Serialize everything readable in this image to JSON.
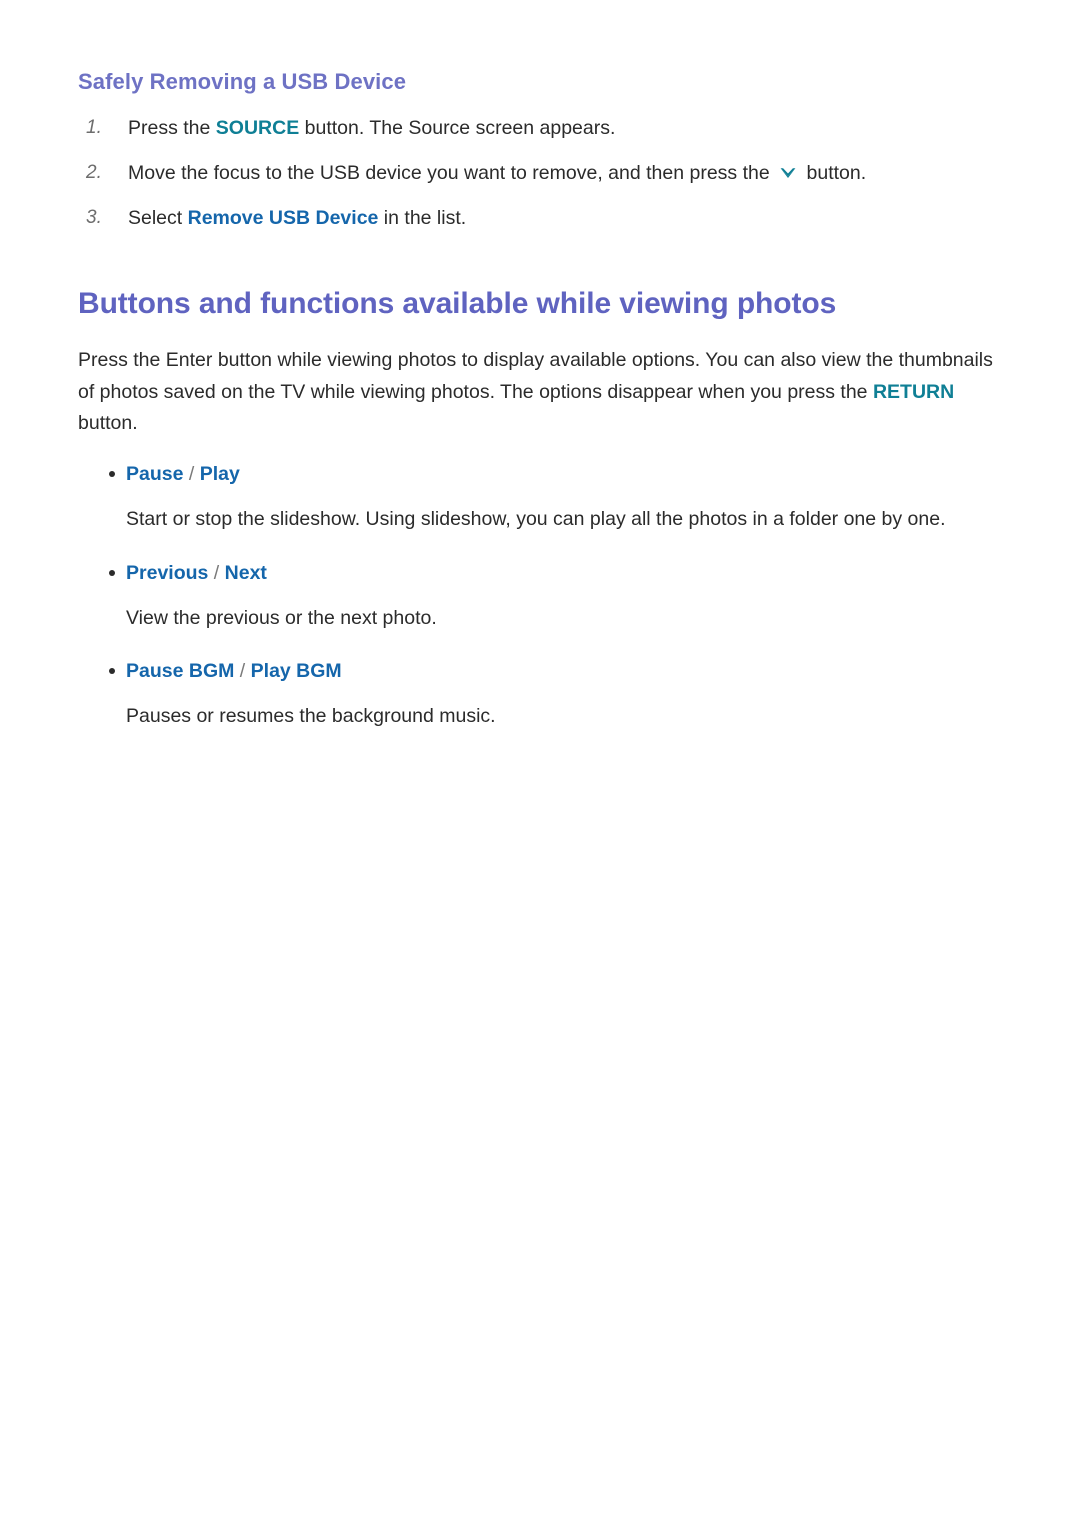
{
  "colors": {
    "heading_purple": "#6e72c4",
    "main_heading_purple": "#5f63c0",
    "accent_teal": "#0f7f95",
    "accent_blue": "#1566ab",
    "body_text": "#2b2b2b",
    "number_gray": "#6d6d6d",
    "page_background": "#ffffff"
  },
  "section": {
    "heading": "Safely Removing a USB Device",
    "steps": [
      {
        "number": "1.",
        "parts": [
          {
            "type": "text",
            "value": "Press the "
          },
          {
            "type": "teal",
            "value": "SOURCE"
          },
          {
            "type": "text",
            "value": " button. The Source screen appears."
          }
        ]
      },
      {
        "number": "2.",
        "parts": [
          {
            "type": "text",
            "value": "Move the focus to the USB device you want to remove, and then press the "
          },
          {
            "type": "icon",
            "value": "chevron-down-icon"
          },
          {
            "type": "text",
            "value": " button."
          }
        ]
      },
      {
        "number": "3.",
        "parts": [
          {
            "type": "text",
            "value": "Select "
          },
          {
            "type": "blue",
            "value": "Remove USB Device"
          },
          {
            "type": "text",
            "value": " in the list."
          }
        ]
      }
    ]
  },
  "article": {
    "heading": "Buttons and functions available while viewing photos",
    "intro": [
      {
        "type": "text",
        "value": "Press the Enter button while viewing photos to display available options. You can also view the thumbnails of photos saved on the TV while viewing photos. The options disappear when you press the "
      },
      {
        "type": "teal",
        "value": "RETURN"
      },
      {
        "type": "text",
        "value": " button."
      }
    ],
    "options": [
      {
        "terms": [
          "Pause",
          "Play"
        ],
        "separator": "/",
        "description": "Start or stop the slideshow. Using slideshow, you can play all the photos in a folder one by one."
      },
      {
        "terms": [
          "Previous",
          "Next"
        ],
        "separator": "/",
        "description": "View the previous or the next photo."
      },
      {
        "terms": [
          "Pause BGM",
          "Play BGM"
        ],
        "separator": "/",
        "description": "Pauses or resumes the background music."
      }
    ]
  }
}
